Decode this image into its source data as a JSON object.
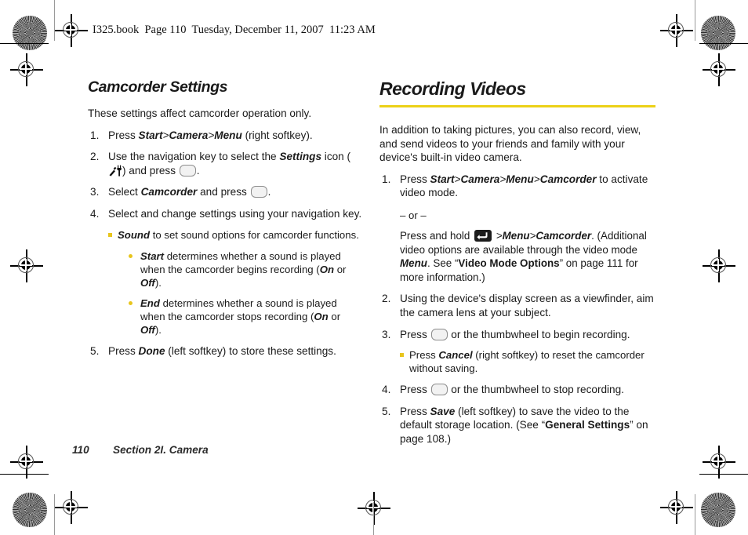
{
  "document": {
    "file_header": "I325.book  Page 110  Tuesday, December 11, 2007  11:23 AM",
    "footer": {
      "page_number": "110",
      "section": "Section 2I. Camera"
    },
    "accent_color": "#ecd117",
    "bullet_color": "#e8c51d"
  },
  "left_column": {
    "heading": "Camcorder Settings",
    "intro": "These settings affect camcorder operation only.",
    "steps": [
      {
        "id": "step-1",
        "parts": [
          {
            "t": "Press ",
            "style": "normal"
          },
          {
            "t": "Start",
            "style": "bold-italic"
          },
          {
            "t": ">",
            "style": "italic"
          },
          {
            "t": "Camera",
            "style": "bold-italic"
          },
          {
            "t": ">",
            "style": "italic"
          },
          {
            "t": "Menu",
            "style": "bold-italic"
          },
          {
            "t": " (right softkey).",
            "style": "normal"
          }
        ]
      },
      {
        "id": "step-2",
        "parts": [
          {
            "t": "Use the navigation key to select the ",
            "style": "normal"
          },
          {
            "t": "Settings",
            "style": "bold-italic"
          },
          {
            "t": " icon (",
            "style": "normal"
          },
          {
            "t": "",
            "style": "icon-settings"
          },
          {
            "t": ") and press ",
            "style": "normal"
          },
          {
            "t": "",
            "style": "key-oval"
          },
          {
            "t": ".",
            "style": "normal"
          }
        ]
      },
      {
        "id": "step-3",
        "parts": [
          {
            "t": "Select ",
            "style": "normal"
          },
          {
            "t": "Camcorder",
            "style": "bold-italic"
          },
          {
            "t": " and press ",
            "style": "normal"
          },
          {
            "t": "",
            "style": "key-oval"
          },
          {
            "t": ".",
            "style": "normal"
          }
        ]
      },
      {
        "id": "step-4",
        "parts": [
          {
            "t": "Select and change settings using your navigation key.",
            "style": "normal"
          }
        ],
        "sub_bullets": [
          {
            "parts": [
              {
                "t": "Sound",
                "style": "bold-italic"
              },
              {
                "t": " to set sound options for camcorder functions.",
                "style": "normal"
              }
            ],
            "sub_sub_bullets": [
              {
                "parts": [
                  {
                    "t": "Start",
                    "style": "bold-italic"
                  },
                  {
                    "t": " determines whether a sound is played when the camcorder begins recording (",
                    "style": "normal"
                  },
                  {
                    "t": "On",
                    "style": "bold-italic"
                  },
                  {
                    "t": " or ",
                    "style": "normal"
                  },
                  {
                    "t": "Off",
                    "style": "bold-italic"
                  },
                  {
                    "t": ").",
                    "style": "normal"
                  }
                ]
              },
              {
                "parts": [
                  {
                    "t": "End",
                    "style": "bold-italic"
                  },
                  {
                    "t": " determines whether a sound is played when the camcorder stops recording (",
                    "style": "normal"
                  },
                  {
                    "t": "On",
                    "style": "bold-italic"
                  },
                  {
                    "t": " or ",
                    "style": "normal"
                  },
                  {
                    "t": "Off",
                    "style": "bold-italic"
                  },
                  {
                    "t": ").",
                    "style": "normal"
                  }
                ]
              }
            ]
          }
        ]
      },
      {
        "id": "step-5",
        "parts": [
          {
            "t": "Press ",
            "style": "normal"
          },
          {
            "t": "Done",
            "style": "bold-italic"
          },
          {
            "t": " (left softkey) to store these settings.",
            "style": "normal"
          }
        ]
      }
    ]
  },
  "right_column": {
    "heading": "Recording Videos",
    "intro": "In addition to taking pictures, you can also record, view, and send videos to your friends and family with your device's built-in video camera.",
    "steps": [
      {
        "id": "step-1",
        "parts": [
          {
            "t": "Press ",
            "style": "normal"
          },
          {
            "t": "Start",
            "style": "bold-italic"
          },
          {
            "t": ">",
            "style": "italic"
          },
          {
            "t": "Camera",
            "style": "bold-italic"
          },
          {
            "t": ">",
            "style": "italic"
          },
          {
            "t": "Menu",
            "style": "bold-italic"
          },
          {
            "t": ">",
            "style": "italic"
          },
          {
            "t": "Camcorder",
            "style": "bold-italic"
          },
          {
            "t": " to activate video mode.",
            "style": "normal"
          }
        ],
        "or_text": "– or –",
        "alt_parts": [
          {
            "t": "Press and hold ",
            "style": "normal"
          },
          {
            "t": "",
            "style": "key-back"
          },
          {
            "t": " >",
            "style": "italic"
          },
          {
            "t": "Menu",
            "style": "bold-italic"
          },
          {
            "t": ">",
            "style": "italic"
          },
          {
            "t": "Camcorder",
            "style": "bold-italic"
          },
          {
            "t": ". (Additional video options are available through the video mode ",
            "style": "normal"
          },
          {
            "t": "Menu",
            "style": "bold-italic"
          },
          {
            "t": ". See “",
            "style": "normal"
          },
          {
            "t": "Video Mode Options",
            "style": "bold"
          },
          {
            "t": "” on page 111 for more information.)",
            "style": "normal"
          }
        ]
      },
      {
        "id": "step-2",
        "parts": [
          {
            "t": "Using the device's display screen as a viewfinder, aim the camera lens at your subject.",
            "style": "normal"
          }
        ]
      },
      {
        "id": "step-3",
        "parts": [
          {
            "t": "Press ",
            "style": "normal"
          },
          {
            "t": "",
            "style": "key-oval"
          },
          {
            "t": " or the thumbwheel to begin recording.",
            "style": "normal"
          }
        ],
        "sub_bullets": [
          {
            "parts": [
              {
                "t": "Press ",
                "style": "normal"
              },
              {
                "t": "Cancel",
                "style": "bold-italic"
              },
              {
                "t": " (right softkey) to reset the camcorder without saving.",
                "style": "normal"
              }
            ]
          }
        ]
      },
      {
        "id": "step-4",
        "parts": [
          {
            "t": "Press ",
            "style": "normal"
          },
          {
            "t": "",
            "style": "key-oval"
          },
          {
            "t": " or the thumbwheel to stop recording.",
            "style": "normal"
          }
        ]
      },
      {
        "id": "step-5",
        "parts": [
          {
            "t": "Press ",
            "style": "normal"
          },
          {
            "t": "Save",
            "style": "bold-italic"
          },
          {
            "t": " (left softkey) to save the video to the default storage location. (See “",
            "style": "normal"
          },
          {
            "t": "General Settings",
            "style": "bold"
          },
          {
            "t": "” on page 108.)",
            "style": "normal"
          }
        ]
      }
    ]
  },
  "icons": {
    "settings": "settings-tools-icon",
    "select_key": "select-key-icon",
    "back_key": "back-key-icon"
  }
}
